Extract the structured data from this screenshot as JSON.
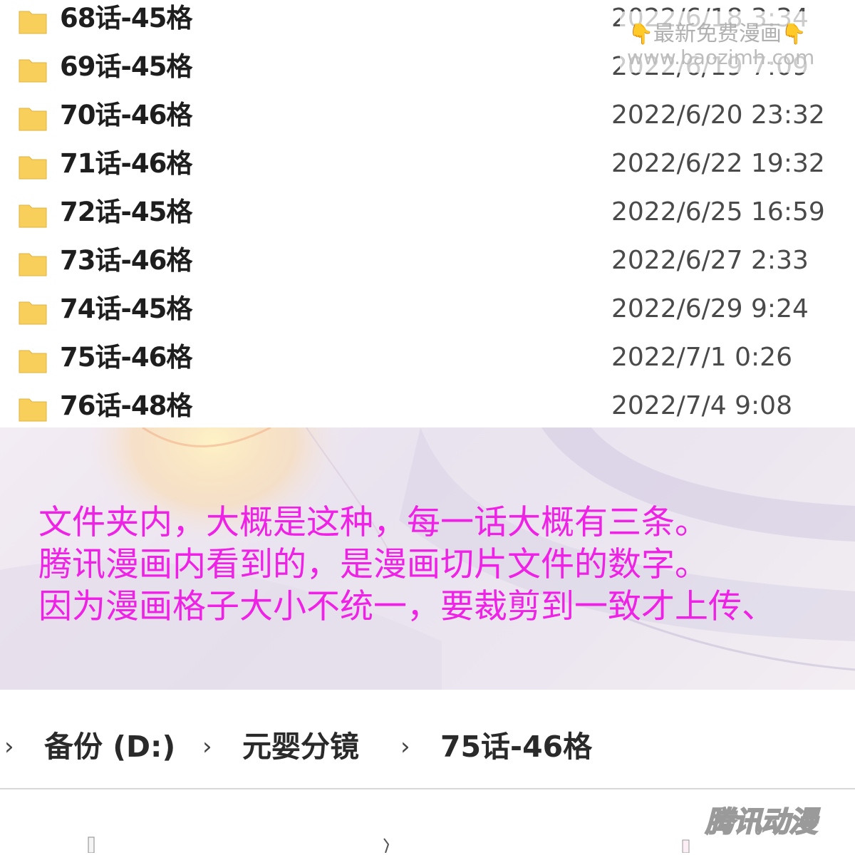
{
  "files": [
    {
      "name": "68话-45格",
      "date": "2022/6/18 3:34"
    },
    {
      "name": "69话-45格",
      "date": "2022/6/19 7:09"
    },
    {
      "name": "70话-46格",
      "date": "2022/6/20 23:32"
    },
    {
      "name": "71话-46格",
      "date": "2022/6/22 19:32"
    },
    {
      "name": "72话-45格",
      "date": "2022/6/25 16:59"
    },
    {
      "name": "73话-46格",
      "date": "2022/6/27 2:33"
    },
    {
      "name": "74话-45格",
      "date": "2022/6/29 9:24"
    },
    {
      "name": "75话-46格",
      "date": "2022/7/1 0:26"
    },
    {
      "name": "76话-48格",
      "date": "2022/7/4 9:08"
    }
  ],
  "watermark": {
    "line1": "最新免费漫画",
    "line2": "www.baozimh.com",
    "hand_icon": "pointing-down-hand-icon"
  },
  "caption": {
    "lines": [
      "文件夹内，大概是这种，每一话大概有三条。",
      "腾讯漫画内看到的，是漫画切片文件的数字。",
      "因为漫画格子大小不统一，要裁剪到一致才上传、"
    ],
    "color": "#f021e6"
  },
  "breadcrumb": {
    "items": [
      "备份 (D:)",
      "元婴分镜",
      "75话-46格"
    ],
    "separator_icon": "chevron-right-icon"
  },
  "logo": {
    "text": "腾讯动漫"
  },
  "colors": {
    "folder": "#f7cf5a",
    "folder_dark": "#e8b93a",
    "caption": "#f021e6"
  }
}
